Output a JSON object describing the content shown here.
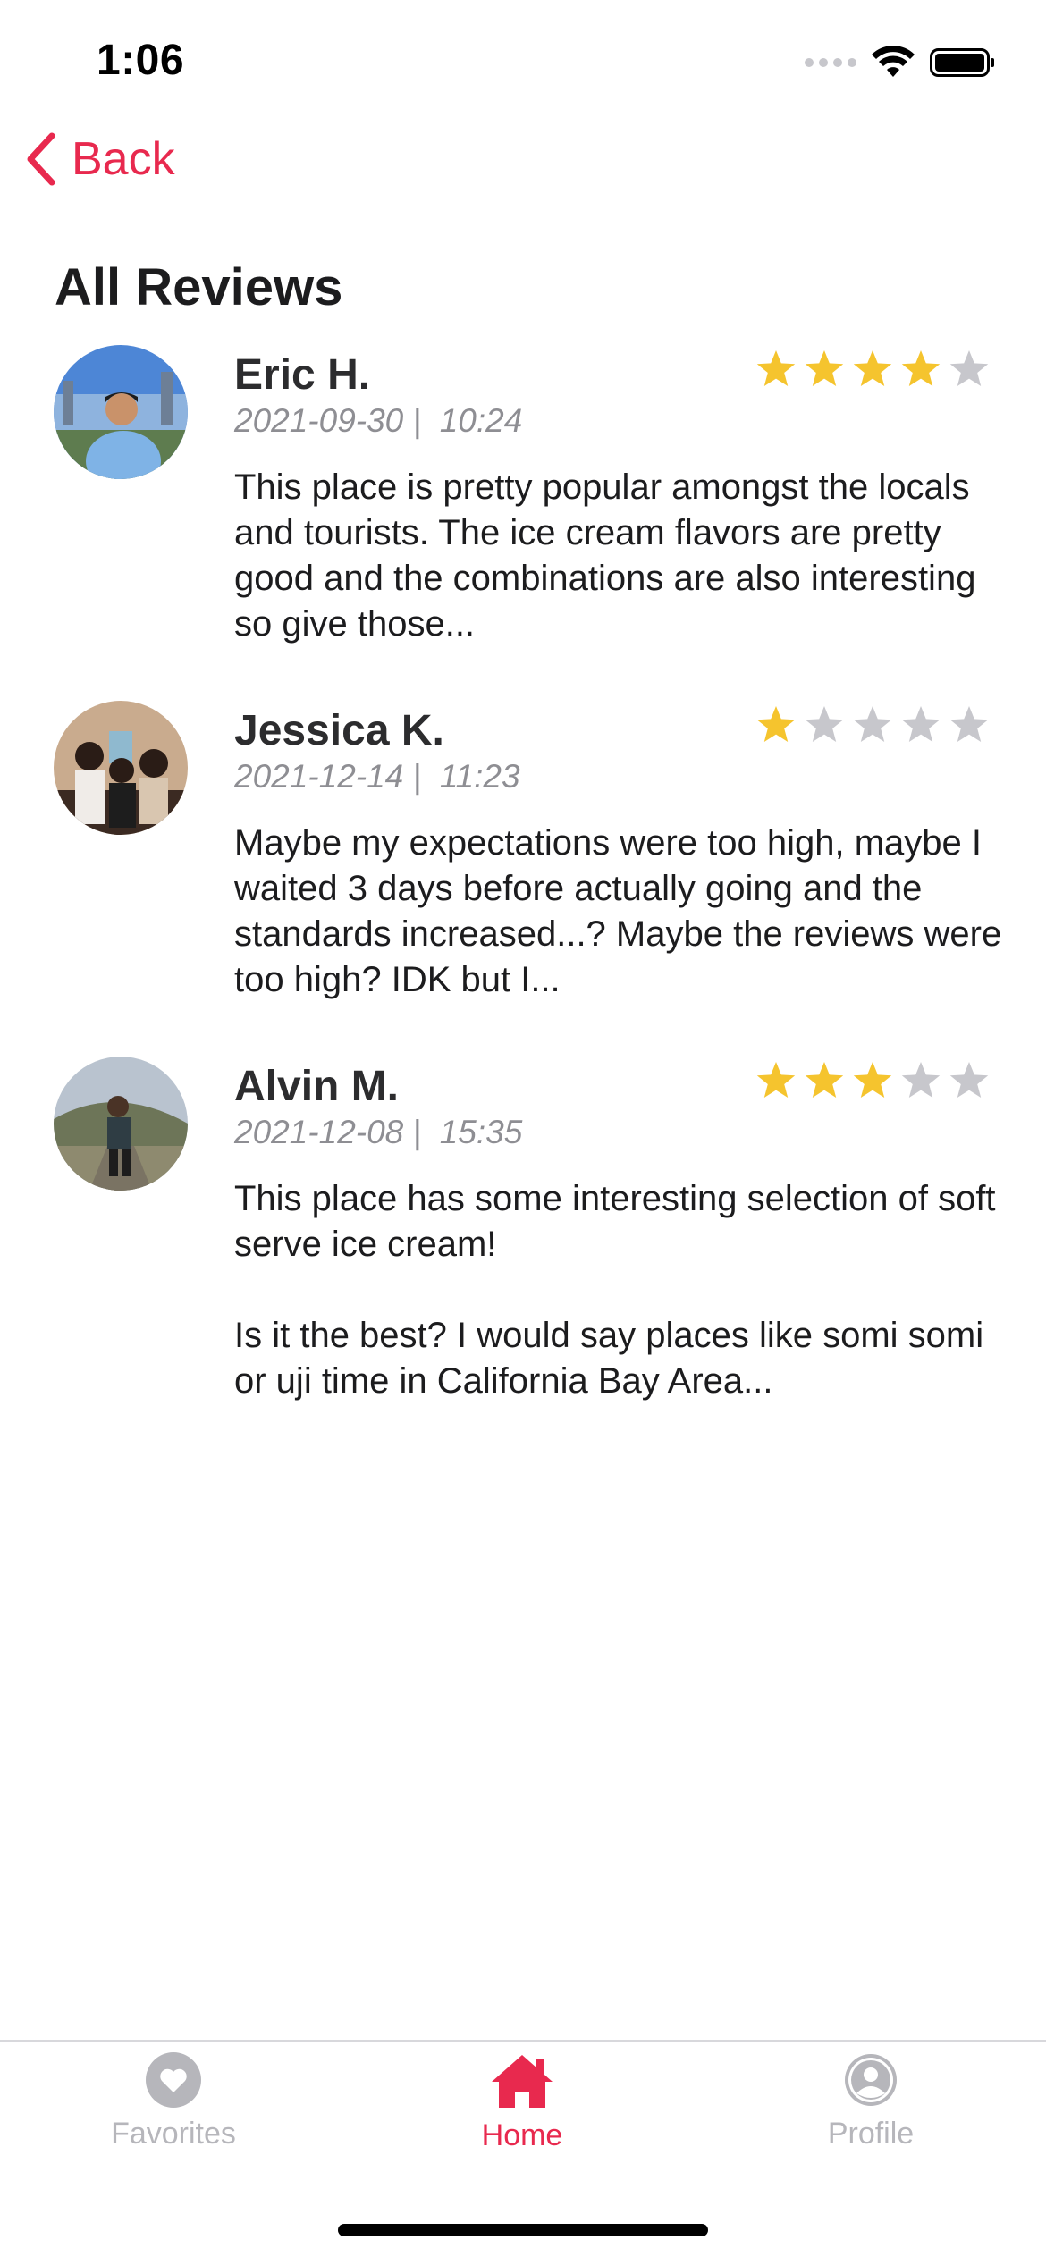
{
  "status_bar": {
    "time": "1:06"
  },
  "nav": {
    "back_label": "Back"
  },
  "page_title": "All Reviews",
  "colors": {
    "accent": "#e8294e",
    "star_filled": "#f5c42e",
    "star_empty": "#c7c7cc",
    "tab_inactive": "#b6b6bb"
  },
  "reviews": [
    {
      "name": "Eric H.",
      "date": "2021-09-30 |  10:24",
      "rating": 4,
      "text": "This place is pretty popular amongst the locals and tourists. The ice cream flavors are pretty good and the combinations are also interesting so give those..."
    },
    {
      "name": "Jessica K.",
      "date": "2021-12-14 |  11:23",
      "rating": 1,
      "text": "Maybe my expectations were too high, maybe I waited 3 days before actually going and the standards increased...? Maybe the reviews were too high?  IDK but I..."
    },
    {
      "name": "Alvin M.",
      "date": "2021-12-08 |  15:35",
      "rating": 3,
      "text": "This place has some interesting selection of soft serve ice cream!\n\nIs it the best? I would say places like somi somi or uji time in California Bay Area..."
    }
  ],
  "tab_bar": {
    "tabs": [
      {
        "label": "Favorites",
        "icon": "heart-icon",
        "active": false
      },
      {
        "label": "Home",
        "icon": "home-icon",
        "active": true
      },
      {
        "label": "Profile",
        "icon": "person-icon",
        "active": false
      }
    ]
  }
}
